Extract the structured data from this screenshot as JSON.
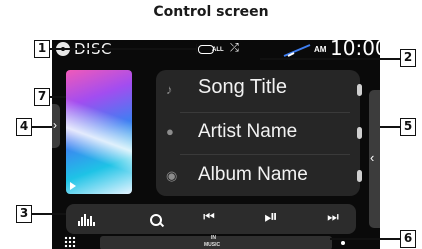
{
  "page": {
    "heading": "Control screen"
  },
  "screen": {
    "source_label": "DISC",
    "repeat_mode": "ALL",
    "am_label": "AM",
    "clock": "10:00",
    "track": {
      "title": "Song Title",
      "artist": "Artist Name",
      "album": "Album Name"
    },
    "status": {
      "in_label": "IN",
      "music_label": "MUSIC"
    }
  },
  "callouts": [
    "1",
    "2",
    "3",
    "4",
    "5",
    "6",
    "7"
  ],
  "colors": {
    "background": "#0a0a0a",
    "panel": "#262626",
    "control_bar": "#2c2c2c",
    "text": "#f2f2f2"
  }
}
